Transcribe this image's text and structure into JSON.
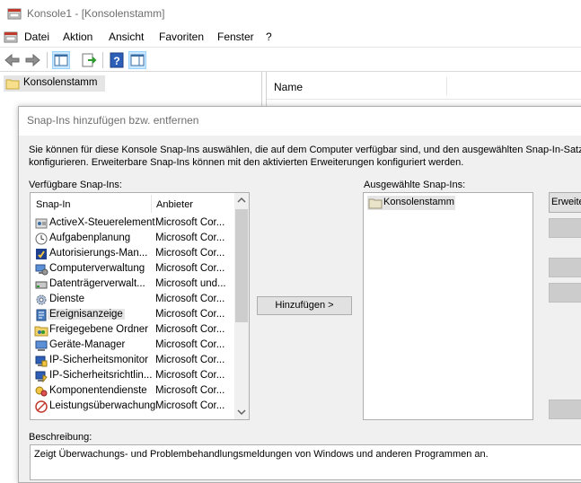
{
  "window": {
    "title": "Konsole1 - [Konsolenstamm]"
  },
  "menu": [
    "Datei",
    "Aktion",
    "Ansicht",
    "Favoriten",
    "Fenster",
    "?"
  ],
  "tree": {
    "root": "Konsolenstamm"
  },
  "list": {
    "column_name": "Name"
  },
  "dialog": {
    "title": "Snap-Ins hinzufügen bzw. entfernen",
    "intro_line1": "Sie können für diese Konsole Snap-Ins auswählen, die auf dem Computer verfügbar sind, und den ausgewählten Snap-In-Satz",
    "intro_line2": "konfigurieren. Erweiterbare Snap-Ins können mit den aktivierten Erweiterungen konfiguriert werden.",
    "available_label": "Verfügbare Snap-Ins:",
    "col_snapin": "Snap-In",
    "col_vendor": "Anbieter",
    "snapins": [
      {
        "name": "ActiveX-Steuerelement",
        "vendor": "Microsoft Cor...",
        "icon": "activex-icon"
      },
      {
        "name": "Aufgabenplanung",
        "vendor": "Microsoft Cor...",
        "icon": "clock-icon"
      },
      {
        "name": "Autorisierungs-Man...",
        "vendor": "Microsoft Cor...",
        "icon": "authorization-icon"
      },
      {
        "name": "Computerverwaltung",
        "vendor": "Microsoft Cor...",
        "icon": "computer-management-icon"
      },
      {
        "name": "Datenträgerverwalt...",
        "vendor": "Microsoft und...",
        "icon": "disk-icon"
      },
      {
        "name": "Dienste",
        "vendor": "Microsoft Cor...",
        "icon": "gear-icon"
      },
      {
        "name": "Ereignisanzeige",
        "vendor": "Microsoft Cor...",
        "icon": "event-viewer-icon"
      },
      {
        "name": "Freigegebene Ordner",
        "vendor": "Microsoft Cor...",
        "icon": "shared-folder-icon"
      },
      {
        "name": "Geräte-Manager",
        "vendor": "Microsoft Cor...",
        "icon": "device-manager-icon"
      },
      {
        "name": "IP-Sicherheitsmonitor",
        "vendor": "Microsoft Cor...",
        "icon": "ip-security-monitor-icon"
      },
      {
        "name": "IP-Sicherheitsrichtlin...",
        "vendor": "Microsoft Cor...",
        "icon": "ip-security-policy-icon"
      },
      {
        "name": "Komponentendienste",
        "vendor": "Microsoft Cor...",
        "icon": "component-services-icon"
      },
      {
        "name": "Leistungsüberwachung",
        "vendor": "Microsoft Cor...",
        "icon": "performance-icon"
      }
    ],
    "add_button": "Hinzufügen >",
    "selected_label": "Ausgewählte Snap-Ins:",
    "selected_items": [
      "Konsolenstamm"
    ],
    "extensions_button": "Erweiter",
    "description_label": "Beschreibung:",
    "description_text": "Zeigt Überwachungs- und Problembehandlungsmeldungen von Windows und anderen Programmen an."
  },
  "colors": {
    "selection": "#cce8ff",
    "dialog_bg": "#f0f0f0",
    "button": "#e1e1e1"
  }
}
